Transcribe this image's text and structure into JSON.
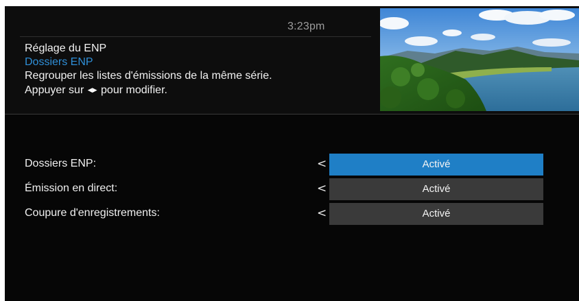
{
  "header": {
    "clock": "3:23pm"
  },
  "info": {
    "title": "Réglage du ENP",
    "subtitle": "Dossiers ENP",
    "description": "Regrouper les listes d'émissions de la même série.",
    "instruction_prefix": "Appuyer sur",
    "instruction_arrows": "◀▶",
    "instruction_suffix": "pour modifier."
  },
  "preview": {
    "icon": "video-preview-landscape-lake"
  },
  "settings": {
    "rows": [
      {
        "label": "Dossiers ENP:",
        "value": "Activé",
        "selected": true,
        "arrow": "<"
      },
      {
        "label": "Émission en direct:",
        "value": "Activé",
        "selected": false,
        "arrow": "<"
      },
      {
        "label": "Coupure d'enregistrements:",
        "value": "Activé",
        "selected": false,
        "arrow": "<"
      }
    ]
  },
  "colors": {
    "accent": "#1f7fc6",
    "subtitle": "#2f8fd8",
    "value_bg": "#3a3a3a",
    "background": "#060606"
  }
}
